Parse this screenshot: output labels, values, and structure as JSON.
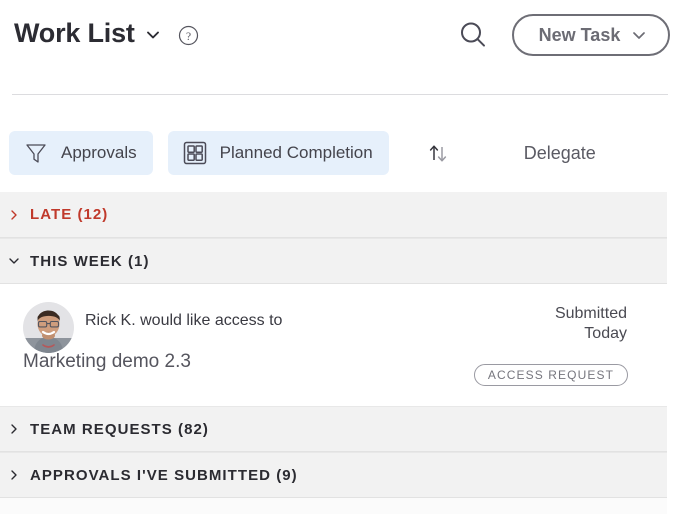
{
  "header": {
    "title": "Work List",
    "title_chevron_icon": "chevron-down-icon",
    "help_icon": "question-circle-icon",
    "search_icon": "search-icon",
    "new_task_label": "New Task",
    "new_task_chevron_icon": "chevron-down-icon"
  },
  "toolbar": {
    "filter_chip": {
      "label": "Approvals",
      "icon": "filter-funnel-icon"
    },
    "view_chip": {
      "label": "Planned Completion",
      "icon": "grid-view-icon"
    },
    "sort_icon": "sort-arrows-icon",
    "delegate_label": "Delegate"
  },
  "sections": [
    {
      "title": "LATE  (12)",
      "expanded": false,
      "chevron_icon": "chevron-right-icon",
      "accent": "#c0392b"
    },
    {
      "title": "THIS WEEK  (1)",
      "expanded": true,
      "chevron_icon": "chevron-down-icon",
      "accent": "#2b2b31"
    },
    {
      "title": "TEAM REQUESTS  (82)",
      "expanded": false,
      "chevron_icon": "chevron-right-icon",
      "accent": "#2b2b31"
    },
    {
      "title": "APPROVALS I'VE SUBMITTED  (9)",
      "expanded": false,
      "chevron_icon": "chevron-right-icon",
      "accent": "#2b2b31"
    }
  ],
  "task": {
    "avatar_icon": "user-avatar-photo",
    "requester_line": "Rick K. would like access to",
    "item_name": "Marketing demo 2.3",
    "status_label": "Submitted",
    "status_date": "Today",
    "badge_label": "ACCESS REQUEST"
  },
  "colors": {
    "chip_background": "#e6f0fb",
    "section_background": "#f2f2f2",
    "late_red": "#c0392b",
    "button_border": "#6e6e76",
    "text_primary": "#2c2c33",
    "text_muted": "#6c6c74"
  }
}
